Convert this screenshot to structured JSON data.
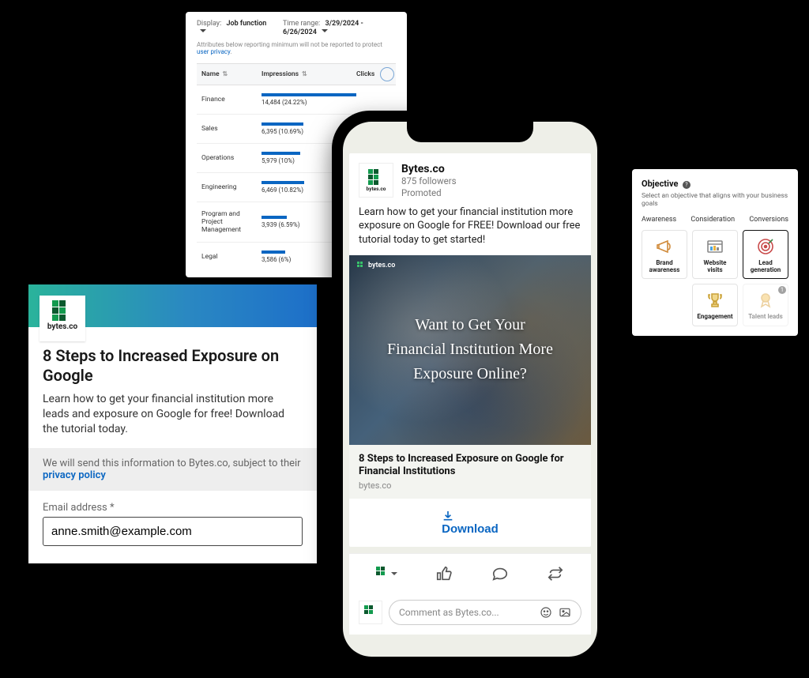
{
  "analytics": {
    "display_label": "Display:",
    "display_value": "Job function",
    "timerange_label": "Time range:",
    "timerange_value": "3/29/2024 - 6/26/2024",
    "note_prefix": "Attributes below reporting minimum will not be reported to protect ",
    "note_link": "user privacy",
    "columns": {
      "name": "Name",
      "impressions": "Impressions",
      "clicks": "Clicks"
    },
    "rows": [
      {
        "name": "Finance",
        "value": "14,484 (24.22%)",
        "bar": 100
      },
      {
        "name": "Sales",
        "value": "6,395 (10.69%)",
        "bar": 44
      },
      {
        "name": "Operations",
        "value": "5,979 (10%)",
        "bar": 41
      },
      {
        "name": "Engineering",
        "value": "6,469 (10.82%)",
        "bar": 45
      },
      {
        "name": "Program and Project Management",
        "value": "3,939 (6.59%)",
        "bar": 27
      },
      {
        "name": "Legal",
        "value": "3,586 (6%)",
        "bar": 25
      }
    ]
  },
  "lead": {
    "brand": "bytes.co",
    "title": "8 Steps to Increased Exposure on Google",
    "desc": "Learn how to get your financial institution more leads and exposure on Google for free! Download the tutorial today.",
    "privacy_prefix": "We will send this information to Bytes.co, subject to their ",
    "privacy_link": "privacy policy",
    "field_label": "Email address *",
    "field_value": "anne.smith@example.com"
  },
  "post": {
    "author": "Bytes.co",
    "followers": "875 followers",
    "promoted": "Promoted",
    "body": "Learn how to get your financial institution more exposure on Google for FREE! Download our free tutorial today to get started!",
    "hero_tag": "bytes.co",
    "hero_line1": "Want to Get Your",
    "hero_line2": "Financial Institution More",
    "hero_line3": "Exposure Online?",
    "link_title": "8 Steps to Increased Exposure on Google for Financial Institutions",
    "link_domain": "bytes.co",
    "download": "Download",
    "comment_placeholder": "Comment as Bytes.co..."
  },
  "objective": {
    "title": "Objective",
    "sub": "Select an objective that aligns with your business goals",
    "tabs": [
      "Awareness",
      "Consideration",
      "Conversions"
    ],
    "cards": [
      {
        "label": "Brand awareness",
        "icon": "megaphone"
      },
      {
        "label": "Website visits",
        "icon": "browser"
      },
      {
        "label": "Lead generation",
        "icon": "target",
        "selected": true
      },
      {
        "label": "Engagement",
        "icon": "trophy"
      },
      {
        "label": "Talent leads",
        "icon": "ribbon",
        "ghost": true,
        "badge": "1"
      }
    ]
  }
}
